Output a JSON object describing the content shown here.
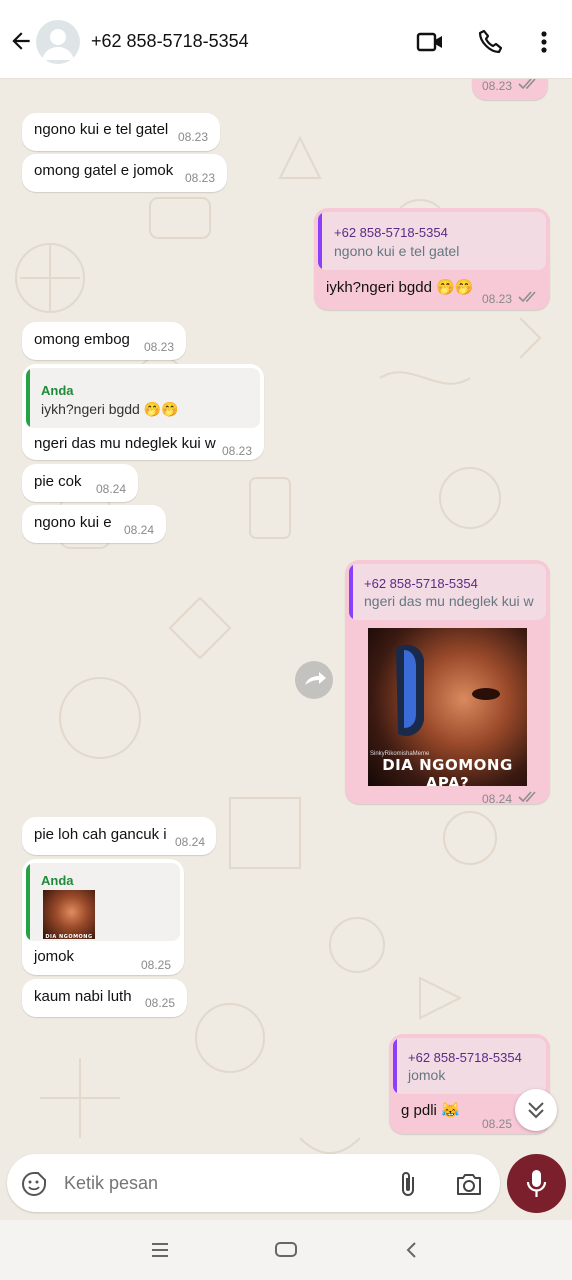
{
  "header": {
    "contact": "+62 858-5718-5354",
    "icons": {
      "back": "arrow-back-icon",
      "avatar": "avatar-icon",
      "video": "video-call-icon",
      "call": "phone-call-icon",
      "menu": "more-vert-icon"
    }
  },
  "colors": {
    "outgoing_bubble": "#f7c8d6",
    "incoming_bubble": "#ffffff",
    "quote_out_bar": "#8a3ffc",
    "quote_in_bar": "#25a244",
    "mic_button": "#7a1f2b",
    "read_tick": "#8e8e8e"
  },
  "messages": [
    {
      "dir": "out",
      "time": "08.23",
      "status": "read"
    },
    {
      "dir": "in",
      "text": "ngono kui e tel gatel",
      "time": "08.23"
    },
    {
      "dir": "in",
      "text": "omong gatel e jomok",
      "time": "08.23"
    },
    {
      "dir": "out",
      "quote_author": "+62 858-5718-5354",
      "quote_text": "ngono kui e tel gatel",
      "text": "iykh?ngeri bgdd 🤭🤭",
      "time": "08.23",
      "status": "read"
    },
    {
      "dir": "in",
      "text": "omong embog",
      "time": "08.23"
    },
    {
      "dir": "in",
      "quote_author": "Anda",
      "quote_text": "iykh?ngeri bgdd 🤭🤭",
      "text": "ngeri das mu ndeglek kui w",
      "time": "08.23"
    },
    {
      "dir": "in",
      "text": "pie cok",
      "time": "08.24"
    },
    {
      "dir": "in",
      "text": "ngono kui e",
      "time": "08.24"
    },
    {
      "dir": "out",
      "quote_author": "+62 858-5718-5354",
      "quote_text": "ngeri das mu ndeglek kui w",
      "image_caption": "DIA NGOMONG APA?",
      "image_watermark": "SinkyRikomishaMeme",
      "time": "08.24",
      "status": "read"
    },
    {
      "dir": "in",
      "text": "pie loh cah gancuk i",
      "time": "08.24"
    },
    {
      "dir": "in",
      "quote_author": "Anda",
      "quote_image_caption": "DIA NGOMONG APA?",
      "text": "jomok",
      "time": "08.25"
    },
    {
      "dir": "in",
      "text": "kaum nabi luth",
      "time": "08.25"
    },
    {
      "dir": "out",
      "quote_author": "+62 858-5718-5354",
      "quote_text": "jomok",
      "text": "g pdli 😹",
      "time": "08.25"
    }
  ],
  "composer": {
    "placeholder": "Ketik pesan",
    "icons": {
      "sticker": "sticker-icon",
      "attach": "paperclip-icon",
      "camera": "camera-icon",
      "mic": "microphone-icon"
    }
  },
  "overlays": {
    "forward": "forward-icon",
    "scroll_down": "double-chevron-down-icon"
  },
  "navbar": {
    "icons": [
      "recent-apps-icon",
      "home-icon",
      "back-nav-icon"
    ]
  }
}
